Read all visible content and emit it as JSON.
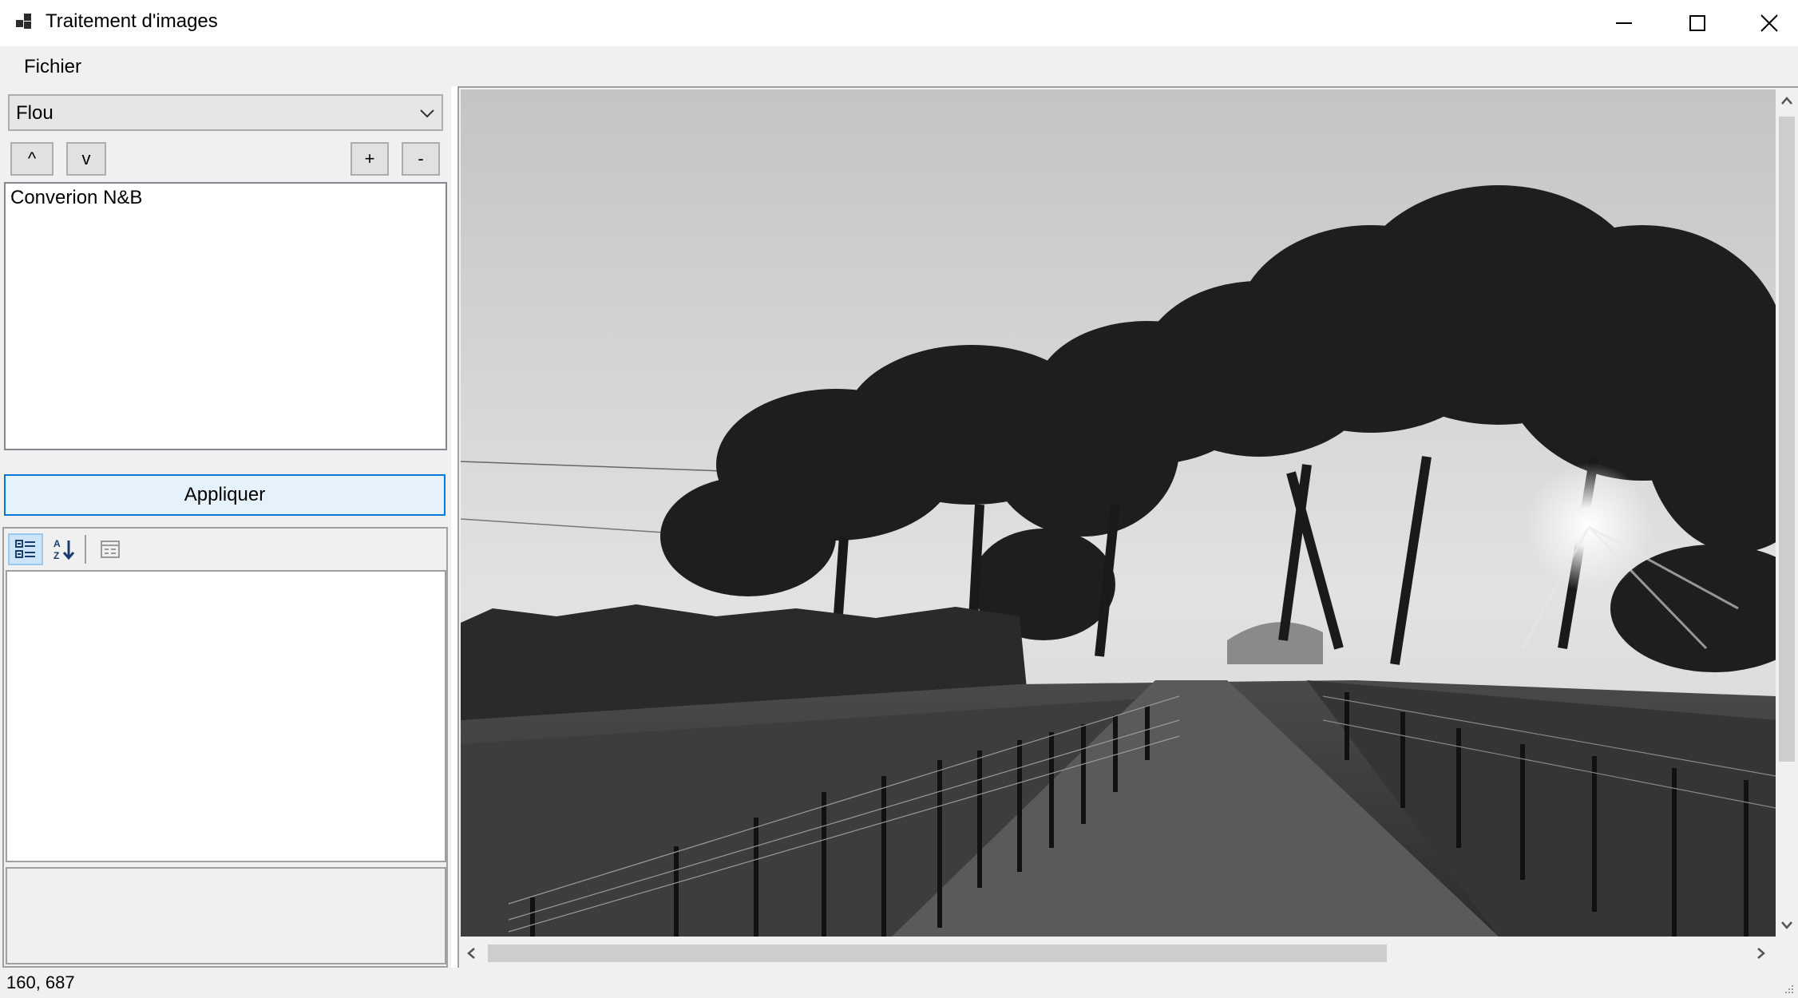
{
  "window": {
    "title": "Traitement d'images",
    "minimize_icon": "minimize-icon",
    "maximize_icon": "maximize-icon",
    "close_icon": "close-icon"
  },
  "menu": {
    "items": [
      {
        "label": "Fichier"
      }
    ]
  },
  "filter_selector": {
    "selected": "Flou"
  },
  "order_buttons": {
    "up_label": "^",
    "down_label": "v",
    "add_label": "+",
    "remove_label": "-"
  },
  "filter_list": {
    "items": [
      "Converion N&B"
    ]
  },
  "apply_button": {
    "label": "Appliquer"
  },
  "property_grid": {
    "toolbar_icons": [
      "categorized-icon",
      "alphabetical-sort-icon",
      "property-pages-icon"
    ]
  },
  "status": {
    "coordinates": "160, 687"
  },
  "colors": {
    "accent": "#0078d7",
    "apply_bg": "#e5f1fb",
    "panel_bg": "#f0f0f0"
  }
}
